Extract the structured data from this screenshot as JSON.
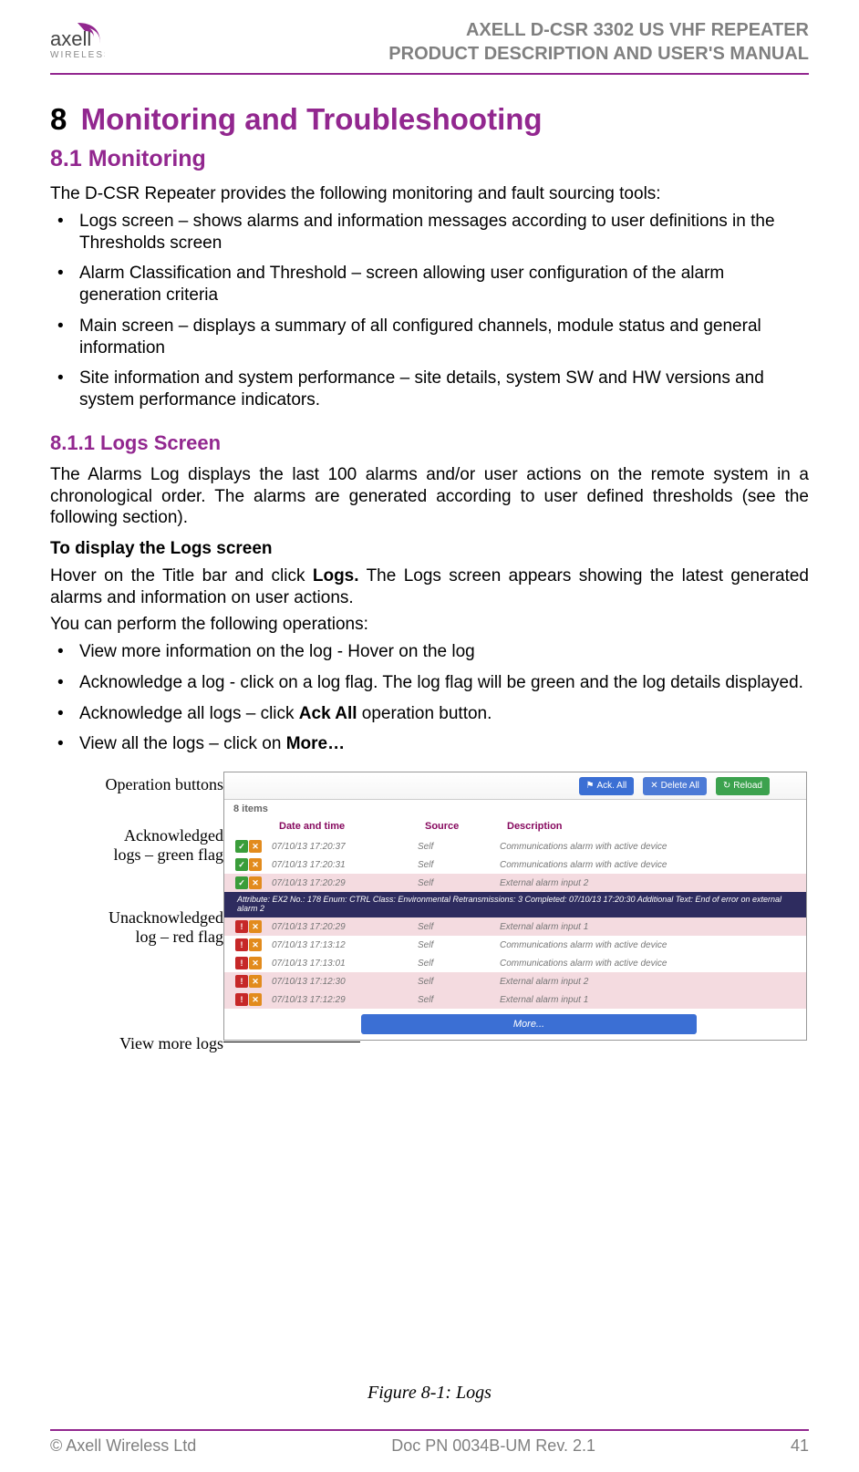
{
  "header": {
    "doc_line1": "AXELL D-CSR 3302 US VHF REPEATER",
    "doc_line2": "PRODUCT DESCRIPTION AND USER'S MANUAL",
    "logo_text": "WIRELESS",
    "logo_brand": "axell"
  },
  "chapter": {
    "num": "8",
    "title": "Monitoring and Troubleshooting"
  },
  "s81": {
    "heading": "8.1    Monitoring",
    "intro": "The D-CSR Repeater provides the following monitoring and fault sourcing tools:",
    "b1": "Logs screen – shows alarms and information messages according to user definitions in the Thresholds screen",
    "b2": "Alarm Classification and Threshold – screen allowing user configuration of the alarm generation criteria",
    "b3": "Main screen – displays a summary of all configured channels, module status and general information",
    "b4": "Site information and system performance – site details, system SW and HW versions and system performance indicators."
  },
  "s811": {
    "heading": "8.1.1   Logs Screen",
    "p1": "The Alarms Log displays the last 100 alarms and/or user actions on the remote system in a chronological order. The alarms are generated according to user defined thresholds (see the following section).",
    "p2_bold": "To display the Logs screen",
    "p3a": "Hover on the Title bar and click ",
    "p3b": "Logs.",
    "p3c": " The Logs screen appears showing the latest generated alarms and information on user actions.",
    "p4": "You can perform the following operations:",
    "b1": "View more information on the log - Hover on the log",
    "b2": "Acknowledge a log - click on a log flag. The log flag will be green and the log details displayed.",
    "b3a": "Acknowledge all logs – click ",
    "b3b": "Ack All",
    "b3c": " operation button.",
    "b4a": "View all the logs – click on ",
    "b4b": "More…"
  },
  "annotations": {
    "a1": "Operation buttons",
    "a2a": "Acknowledged",
    "a2b": "logs – green flag",
    "a3a": "Unacknowledged",
    "a3b": "log – red flag",
    "a4": "View more logs"
  },
  "screenshot": {
    "btn_ack": "Ack. All",
    "btn_del": "Delete All",
    "btn_reload": "Reload",
    "items": "8 items",
    "col_date": "Date and time",
    "col_src": "Source",
    "col_desc": "Description",
    "rows": [
      {
        "flags": "green",
        "date": "07/10/13 17:20:37",
        "src": "Self",
        "desc": "Communications alarm with active device",
        "pink": false
      },
      {
        "flags": "green",
        "date": "07/10/13 17:20:31",
        "src": "Self",
        "desc": "Communications alarm with active device",
        "pink": false
      },
      {
        "flags": "green",
        "date": "07/10/13 17:20:29",
        "src": "Self",
        "desc": "External alarm input 2",
        "pink": true
      }
    ],
    "detail_bar": "Attribute: EX2    No.: 178    Enum: CTRL    Class: Environmental    Retransmissions: 3    Completed: 07/10/13 17:20:30   Additional Text: End of error on external alarm 2",
    "rows2": [
      {
        "flags": "red",
        "date": "07/10/13 17:20:29",
        "src": "Self",
        "desc": "External alarm input 1",
        "pink": true
      },
      {
        "flags": "red",
        "date": "07/10/13 17:13:12",
        "src": "Self",
        "desc": "Communications alarm with active device",
        "pink": false
      },
      {
        "flags": "red",
        "date": "07/10/13 17:13:01",
        "src": "Self",
        "desc": "Communications alarm with active device",
        "pink": false
      },
      {
        "flags": "red",
        "date": "07/10/13 17:12:30",
        "src": "Self",
        "desc": "External alarm input 2",
        "pink": true
      },
      {
        "flags": "red",
        "date": "07/10/13 17:12:29",
        "src": "Self",
        "desc": "External alarm input 1",
        "pink": true
      }
    ],
    "more": "More..."
  },
  "figure_caption": "Figure 8-1:  Logs",
  "footer": {
    "left": "© Axell Wireless Ltd",
    "center": "Doc PN 0034B-UM Rev. 2.1",
    "right": "41"
  }
}
